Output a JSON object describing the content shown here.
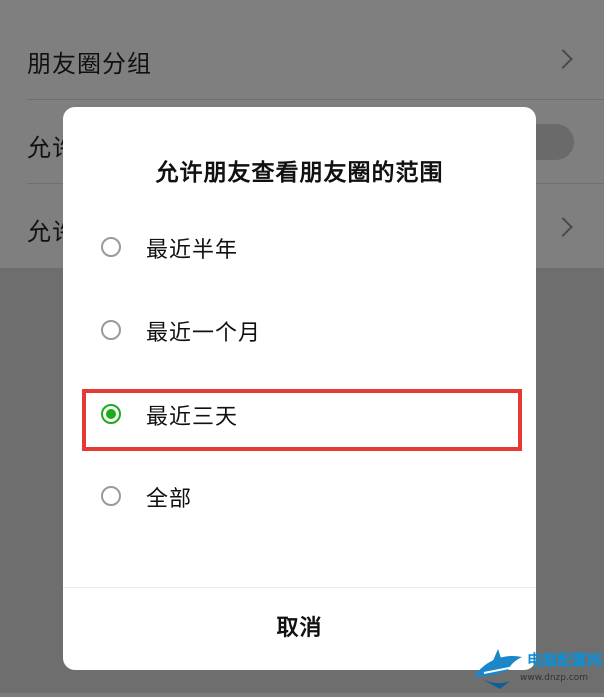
{
  "background": {
    "rows": [
      {
        "label": "朋友圈分组",
        "control": "chevron"
      },
      {
        "label": "允许",
        "control": "toggle"
      },
      {
        "label": "允许",
        "control": "chevron"
      }
    ]
  },
  "dialog": {
    "title": "允许朋友查看朋友圈的范围",
    "options": [
      {
        "label": "最近半年",
        "checked": false
      },
      {
        "label": "最近一个月",
        "checked": false
      },
      {
        "label": "最近三天",
        "checked": true
      },
      {
        "label": "全部",
        "checked": false
      }
    ],
    "cancel_label": "取消"
  },
  "colors": {
    "accent_green": "#1aad19",
    "highlight_red": "#e53935"
  },
  "watermark": {
    "text": "电脑配置网",
    "url": "www.dnzp.com"
  }
}
